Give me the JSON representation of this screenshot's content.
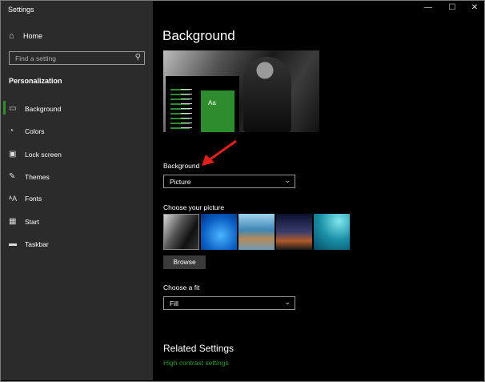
{
  "window": {
    "title": "Settings",
    "minimize": "—",
    "maximize": "☐",
    "close": "✕"
  },
  "sidebar": {
    "home_label": "Home",
    "search_placeholder": "Find a setting",
    "section": "Personalization",
    "items": [
      {
        "label": "Background",
        "icon": "picture-icon"
      },
      {
        "label": "Colors",
        "icon": "palette-icon"
      },
      {
        "label": "Lock screen",
        "icon": "lock-screen-icon"
      },
      {
        "label": "Themes",
        "icon": "themes-icon"
      },
      {
        "label": "Fonts",
        "icon": "fonts-icon"
      },
      {
        "label": "Start",
        "icon": "start-icon"
      },
      {
        "label": "Taskbar",
        "icon": "taskbar-icon"
      }
    ]
  },
  "main": {
    "heading": "Background",
    "preview_tile_text": "Aa",
    "background_label": "Background",
    "background_value": "Picture",
    "choose_picture_label": "Choose your picture",
    "browse_label": "Browse",
    "fit_label": "Choose a fit",
    "fit_value": "Fill",
    "related_heading": "Related Settings",
    "related_link": "High contrast settings"
  },
  "colors": {
    "accent": "#2e8b2e",
    "sidebar_bg": "#2b2b2b",
    "main_bg": "#000000",
    "arrow": "#e0201b"
  }
}
